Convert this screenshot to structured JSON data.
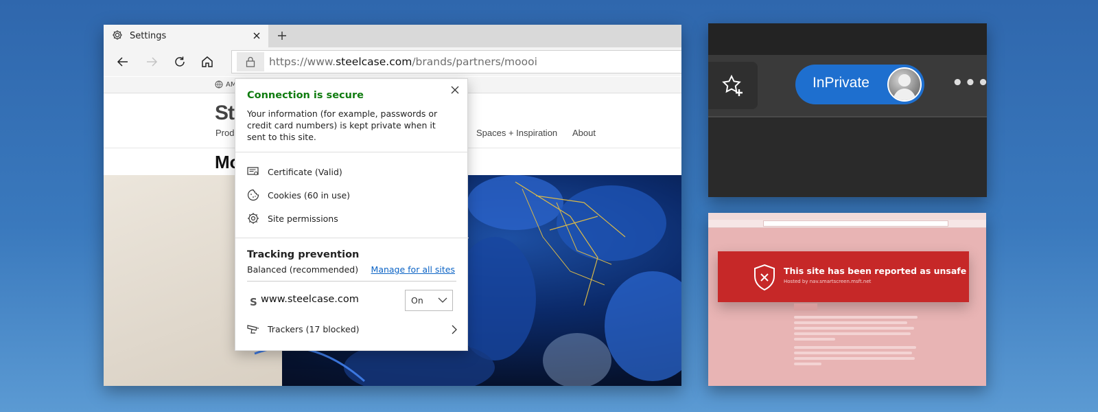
{
  "browser": {
    "tab": {
      "title": "Settings"
    },
    "address": {
      "prefix": "https://www.",
      "domain": "steelcase.com",
      "path": "/brands/partners/moooi"
    },
    "favorites_bar": {
      "item": "AM"
    },
    "site": {
      "logo": "St",
      "nav": [
        "Prod",
        "Spaces + Inspiration",
        "About"
      ],
      "heading": "Mo"
    }
  },
  "site_info_popup": {
    "secure_title": "Connection is secure",
    "secure_description": "Your information (for example, passwords or credit card numbers) is kept private when it sent to this site.",
    "certificate": "Certificate (Valid)",
    "cookies": "Cookies (60 in use)",
    "permissions": "Site permissions",
    "tracking": {
      "title": "Tracking prevention",
      "level": "Balanced (recommended)",
      "manage_link": "Manage for all sites",
      "site_letter": "S",
      "site_domain": "www.steelcase.com",
      "select_value": "On",
      "trackers": "Trackers (17 blocked)"
    }
  },
  "inprivate_panel": {
    "pill_label": "InPrivate",
    "more_label": "•••",
    "colors": {
      "pill": "#1e6fcf",
      "background": "#2a2a2a"
    }
  },
  "unsafe_panel": {
    "banner_title": "This site has been reported as unsafe",
    "banner_sub": "Hosted by nav.smartscreen.msft.net",
    "colors": {
      "banner": "#c62828",
      "page": "#e8b4b4"
    }
  },
  "icons": [
    "gear-icon",
    "close-icon",
    "plus-icon",
    "back-arrow-icon",
    "forward-arrow-icon",
    "refresh-icon",
    "home-icon",
    "lock-icon",
    "globe-icon",
    "certificate-icon",
    "cookie-icon",
    "gear-icon",
    "tracker-icon",
    "chevron-right-icon",
    "chevron-down-icon",
    "favorite-add-icon",
    "avatar-icon",
    "shield-x-icon"
  ]
}
